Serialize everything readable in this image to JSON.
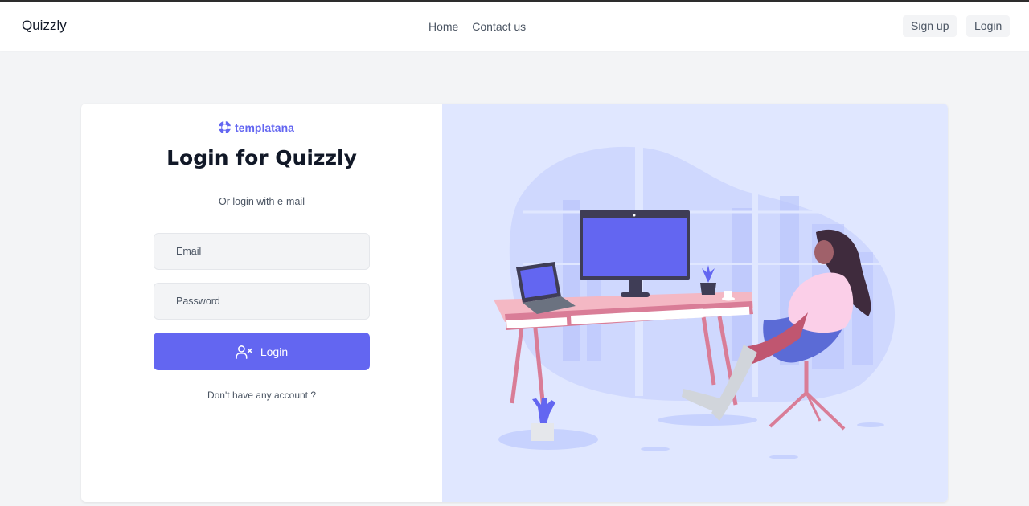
{
  "nav": {
    "brand": "Quizzly",
    "links": [
      "Home",
      "Contact us"
    ],
    "signup_label": "Sign up",
    "login_label": "Login"
  },
  "form": {
    "logo_text": "templatana",
    "title": "Login for Quizzly",
    "divider_text": "Or login with e-mail",
    "email_placeholder": "Email",
    "password_placeholder": "Password",
    "login_button_label": "Login",
    "signup_prompt": "Don't have any account ?"
  },
  "colors": {
    "accent": "#6366f1",
    "illustration_bg": "#e0e7ff"
  }
}
